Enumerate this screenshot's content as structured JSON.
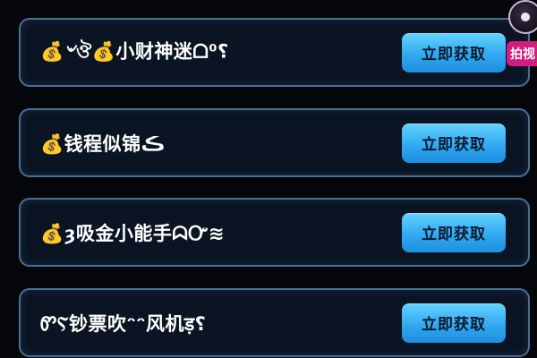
{
  "items": [
    {
      "title": "💰৺ঔ💰小财神迷ᗝ⁰⸮",
      "button_label": "立即获取"
    },
    {
      "title": "💰钱程似锦ڪ",
      "button_label": "立即获取"
    },
    {
      "title": "💰ȝ吸金小能手ᗣᏅ≋",
      "button_label": "立即获取"
    },
    {
      "title": "ᏛⲊ钞票吹ᵔᵔ风机ड़⸮",
      "button_label": "立即获取"
    }
  ],
  "overlay": {
    "badge_text": "拍视"
  }
}
